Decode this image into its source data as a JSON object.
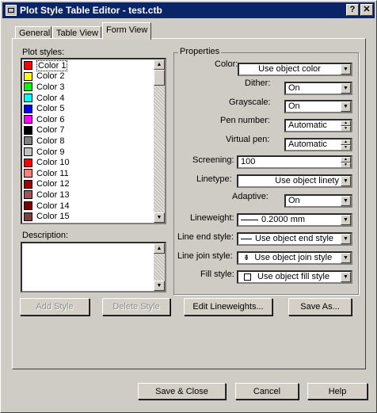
{
  "window": {
    "title": "Plot Style Table Editor - test.ctb",
    "help_glyph": "?",
    "close_glyph": "✕"
  },
  "tabs": [
    {
      "label": "General"
    },
    {
      "label": "Table View"
    },
    {
      "label": "Form View",
      "active": true
    }
  ],
  "plot_styles": {
    "label": "Plot styles:",
    "items": [
      {
        "label": "Color 1",
        "color": "#ff0000"
      },
      {
        "label": "Color 2",
        "color": "#ffff00"
      },
      {
        "label": "Color 3",
        "color": "#00ff00"
      },
      {
        "label": "Color 4",
        "color": "#00ffff"
      },
      {
        "label": "Color 5",
        "color": "#0000ff"
      },
      {
        "label": "Color 6",
        "color": "#ff00ff"
      },
      {
        "label": "Color 7",
        "color": "#000000"
      },
      {
        "label": "Color 8",
        "color": "#808080"
      },
      {
        "label": "Color 9",
        "color": "#c0c0c0"
      },
      {
        "label": "Color 10",
        "color": "#ff0000"
      },
      {
        "label": "Color 11",
        "color": "#ff7f7f"
      },
      {
        "label": "Color 12",
        "color": "#a50000"
      },
      {
        "label": "Color 13",
        "color": "#a55252"
      },
      {
        "label": "Color 14",
        "color": "#7f0000"
      },
      {
        "label": "Color 15",
        "color": "#7f3f3f"
      }
    ],
    "selected_index": 0
  },
  "description": {
    "label": "Description:",
    "value": ""
  },
  "properties": {
    "title": "Properties",
    "color": {
      "label": "Color:",
      "value": "Use object color"
    },
    "dither": {
      "label": "Dither:",
      "value": "On"
    },
    "grayscale": {
      "label": "Grayscale:",
      "value": "On"
    },
    "pen_number": {
      "label": "Pen number:",
      "value": "Automatic"
    },
    "virtual_pen": {
      "label": "Virtual pen:",
      "value": "Automatic"
    },
    "screening": {
      "label": "Screening:",
      "value": "100"
    },
    "linetype": {
      "label": "Linetype:",
      "value": "Use object linety"
    },
    "adaptive": {
      "label": "Adaptive:",
      "value": "On"
    },
    "lineweight": {
      "label": "Lineweight:",
      "value": "0.2000 mm"
    },
    "line_end_style": {
      "label": "Line end style:",
      "value": "Use object end style"
    },
    "line_join_style": {
      "label": "Line join style:",
      "value": "Use object join style"
    },
    "fill_style": {
      "label": "Fill style:",
      "value": "Use object fill style"
    }
  },
  "buttons": {
    "add_style": "Add Style",
    "delete_style": "Delete Style",
    "edit_lineweights": "Edit Lineweights...",
    "save_as": "Save As...",
    "save_close": "Save & Close",
    "cancel": "Cancel",
    "help": "Help"
  }
}
